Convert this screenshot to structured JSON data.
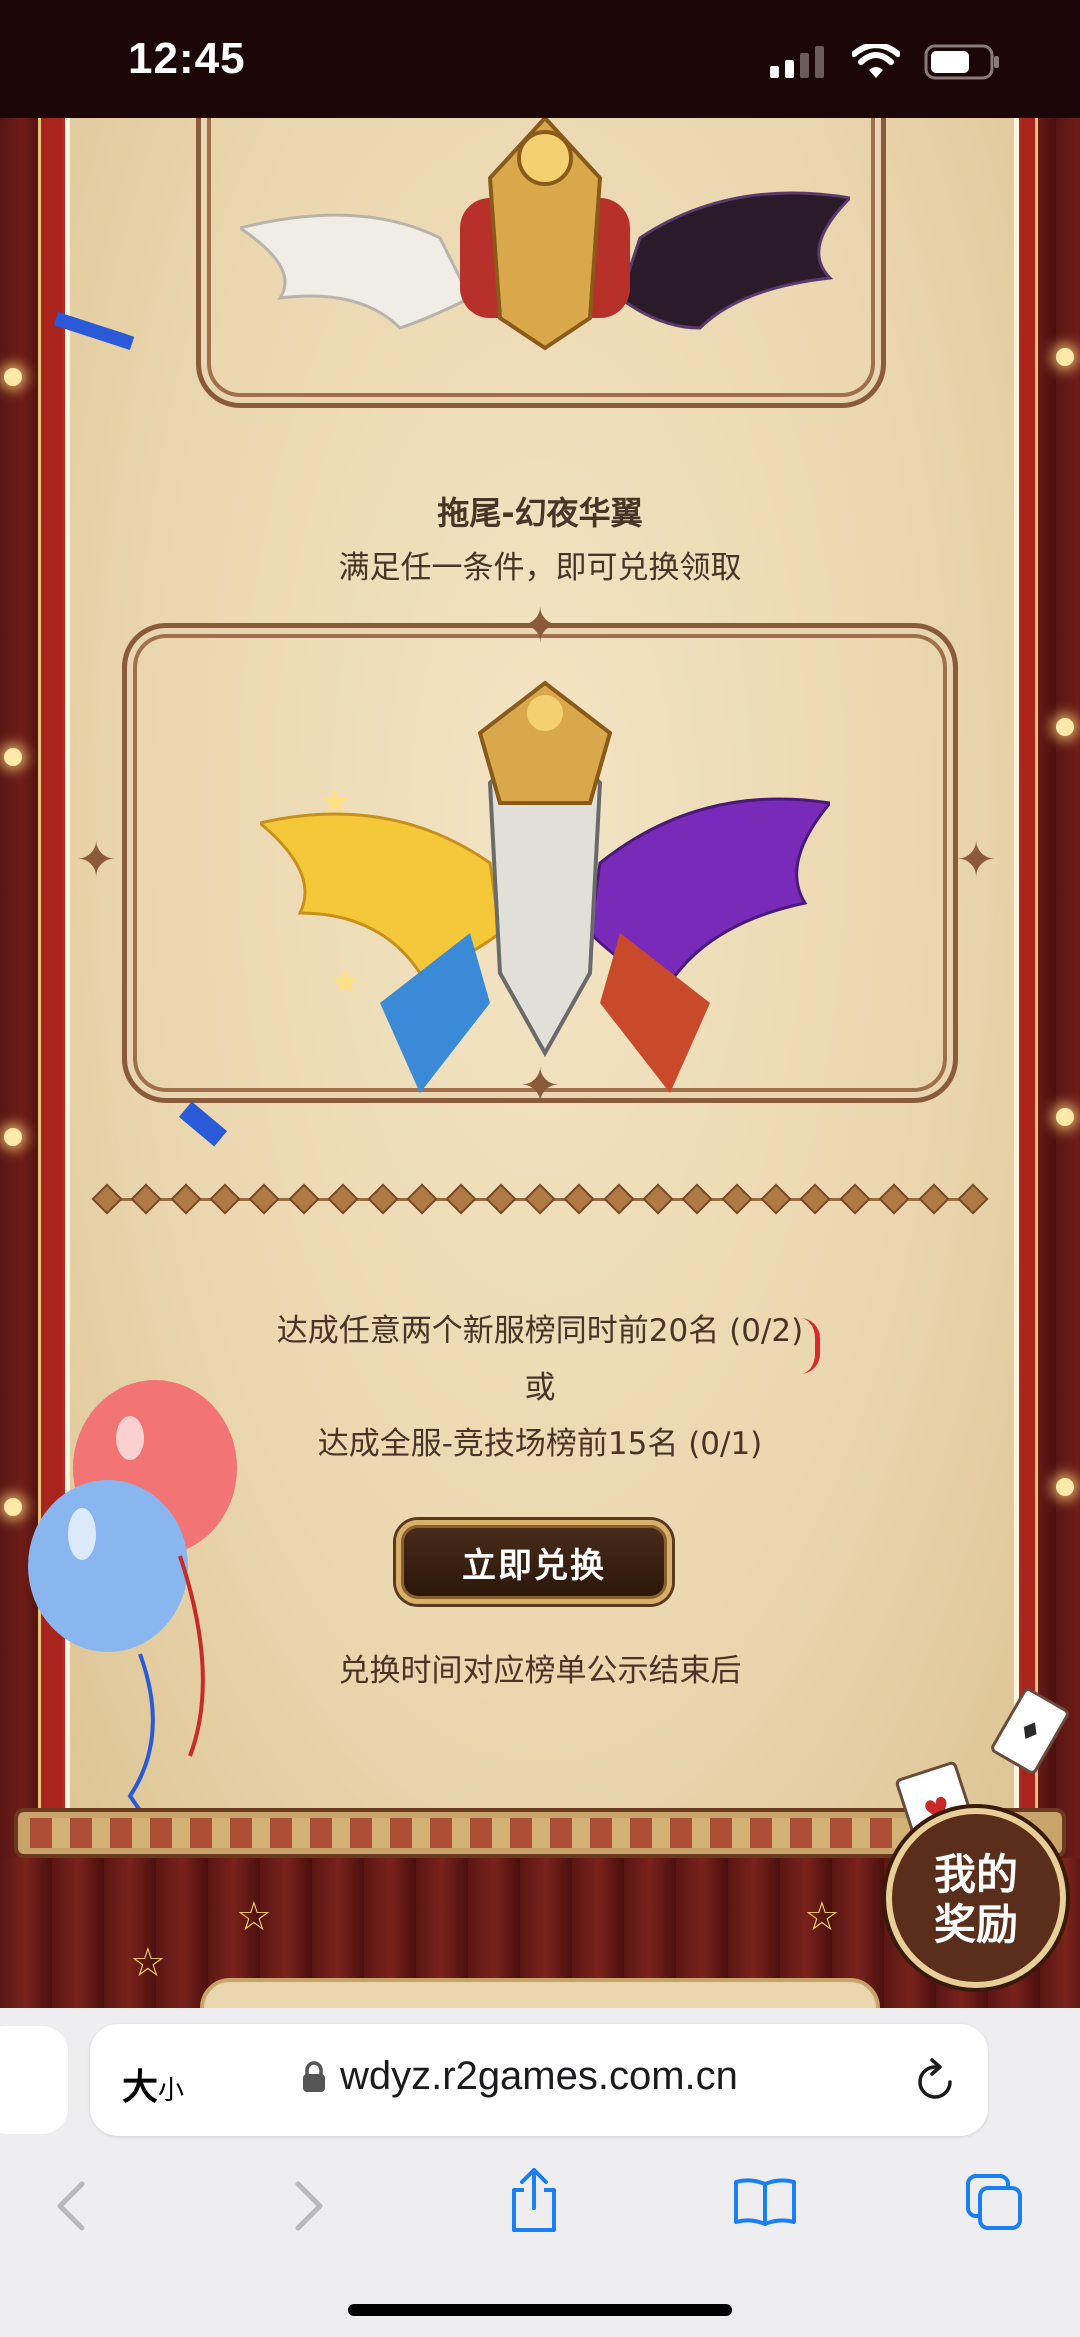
{
  "status_bar": {
    "time": "12:45"
  },
  "rewards": {
    "item_name": "拖尾-幻夜华翼",
    "item_condition_note": "满足任一条件，即可兑换领取",
    "condition_1": "达成任意两个新服榜同时前20名 (0/2)",
    "condition_or": "或",
    "condition_2": "达成全服-竞技场榜前15名 (0/1)",
    "redeem_label": "立即兑换",
    "redeem_time_note": "兑换时间对应榜单公示结束后",
    "my_rewards_line1": "我的",
    "my_rewards_line2": "奖励"
  },
  "browser": {
    "text_size_label": "大",
    "text_size_small": "小",
    "url": "wdyz.r2games.com.cn"
  },
  "colors": {
    "brand_text": "#4a3426",
    "curtain_red": "#6e1d18",
    "gold": "#d8b06a",
    "parchment": "#ead6ae",
    "ios_blue": "#1a7ef5"
  }
}
